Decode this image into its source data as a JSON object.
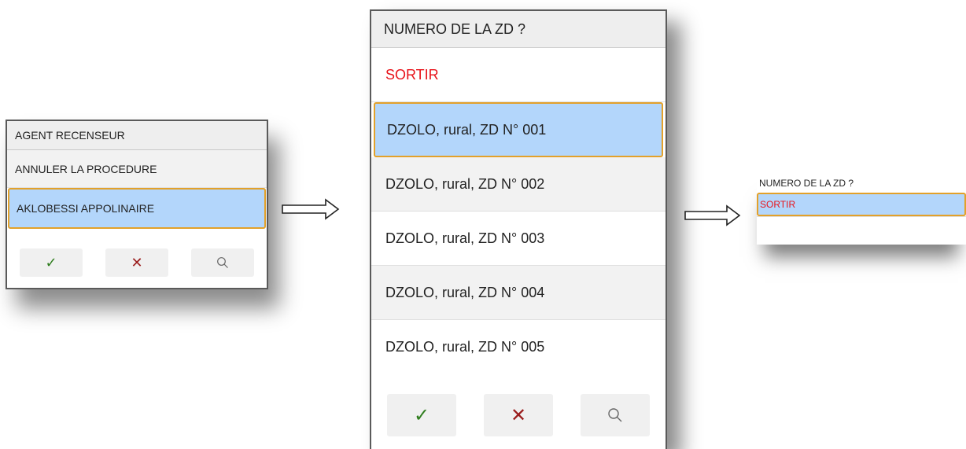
{
  "dialog1": {
    "title": "AGENT RECENSEUR",
    "items": [
      "ANNULER LA PROCEDURE",
      "AKLOBESSI APPOLINAIRE"
    ],
    "buttons": {
      "ok": "✓",
      "cancel": "✕"
    }
  },
  "dialog2": {
    "title": "NUMERO DE LA ZD ?",
    "items": [
      "SORTIR",
      "DZOLO, rural, ZD N° 001",
      "DZOLO, rural, ZD N° 002",
      "DZOLO, rural, ZD N° 003",
      "DZOLO, rural, ZD N° 004",
      "DZOLO, rural, ZD N° 005"
    ],
    "buttons": {
      "ok": "✓",
      "cancel": "✕"
    }
  },
  "dialog3": {
    "title": "NUMERO DE LA ZD ?",
    "items": [
      "SORTIR"
    ]
  },
  "colors": {
    "selected": "#b3d6fb",
    "selected_border": "#e3a12a",
    "exit_text": "#e8131a",
    "confirm": "#2f7d1e",
    "cancel": "#9a1c1c"
  },
  "icons": [
    "check-icon",
    "close-icon",
    "search-icon",
    "right-arrow-icon"
  ]
}
